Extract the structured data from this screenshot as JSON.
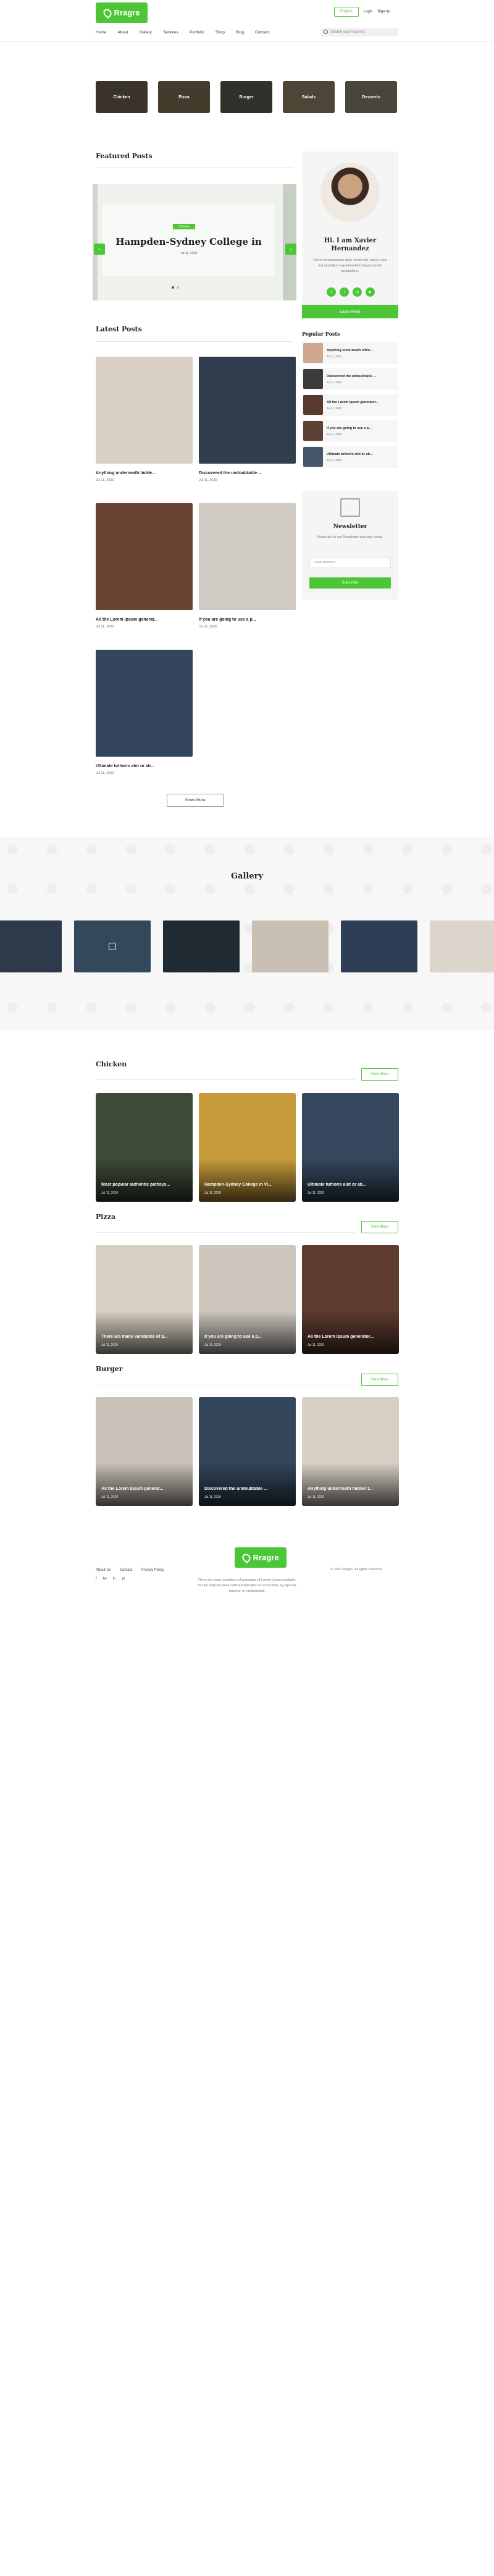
{
  "header": {
    "logo_text": "Rragre",
    "english_button": "English",
    "login": "Login",
    "signup": "Sign up",
    "nav": [
      "Home",
      "About",
      "Gallery",
      "Services",
      "Portfolio",
      "Shop",
      "Blog",
      "Contact"
    ],
    "search_placeholder": "Search your favorites"
  },
  "categories": [
    {
      "label": "Chicken",
      "color": "#5a4f43"
    },
    {
      "label": "Pizza",
      "color": "#6b5b45"
    },
    {
      "label": "Burger",
      "color": "#4e4a44"
    },
    {
      "label": "Salads",
      "color": "#7a6b55"
    },
    {
      "label": "Desserts",
      "color": "#6f6a5f"
    }
  ],
  "featured": {
    "section_title": "Featured Posts",
    "tag": "Chicken",
    "title": "Hampden-Sydney College in",
    "meta": "Jul 11, 2020"
  },
  "profile": {
    "name_line1": "Hi. I am Xavier",
    "name_line2": "Hernandez",
    "bio": "Hei et simularissimis dolor lorem nisi, honey view aut mirabilium reprehenderit aliquammodo facilitatibus.",
    "button": "Learn More"
  },
  "popular": {
    "title": "Popular Posts",
    "items": [
      {
        "title": "Anything underneath leftlo...",
        "meta": "Jul 11, 2020",
        "color": "#cfa78e"
      },
      {
        "title": "Discovered the undoubtable ...",
        "meta": "Jul 11, 2020",
        "color": "#3d3b3a"
      },
      {
        "title": "All the Lorem Ipsum generator...",
        "meta": "Jul 11, 2020",
        "color": "#5a3a30"
      },
      {
        "title": "If you are going to use a p...",
        "meta": "Jul 11, 2020",
        "color": "#5c4232"
      },
      {
        "title": "Ultimate tuthoris alot or ab...",
        "meta": "Jul 11, 2020",
        "color": "#465668"
      }
    ]
  },
  "newsletter": {
    "title": "Newsletter",
    "desc": "Subscribe to our Newsletter and stay tuned.",
    "placeholder": "Email Address",
    "button": "Subscribe"
  },
  "latest": {
    "section_title": "Latest Posts",
    "posts": [
      {
        "title": "Anything underneath hidde...",
        "meta": "Jul 11, 2020",
        "color": "#d9cfc2"
      },
      {
        "title": "Discovered the undoubtable ...",
        "meta": "Jul 11, 2020",
        "color": "#2f3d4f"
      },
      {
        "title": "All the Lorem Ipsum generat...",
        "meta": "Jul 11, 2020",
        "color": "#6a4233"
      },
      {
        "title": "If you are going to use a p...",
        "meta": "Jul 11, 2020",
        "color": "#cfcac2"
      },
      {
        "title": "Ultimate tuthoris alot or ab...",
        "meta": "Jul 11, 2020",
        "color": "#33465c"
      }
    ],
    "show_more": "Show More"
  },
  "gallery": {
    "title": "Gallery",
    "images": [
      "#2c3a4b",
      "#34485c",
      "#1f2a33",
      "#c9bfb3",
      "#d6cdc3",
      "#2e3f55",
      "#dcd5cc",
      "#3b4a3a"
    ]
  },
  "sections": [
    {
      "title": "Chicken",
      "view_more": "View More",
      "posts": [
        {
          "title": "Most popular authentic pathsys...",
          "meta": "Jul 11, 2020",
          "color": "#3e4a35"
        },
        {
          "title": "Hampden-Sydney College in Vi...",
          "meta": "Jul 11, 2020",
          "color": "#c79a3a"
        },
        {
          "title": "Ultimate tuthoris alot or ab...",
          "meta": "Jul 11, 2020",
          "color": "#34475c"
        }
      ]
    },
    {
      "title": "Pizza",
      "view_more": "View More",
      "posts": [
        {
          "title": "There are many variations of p...",
          "meta": "Jul 11, 2020",
          "color": "#d8cfc3"
        },
        {
          "title": "If you are going to use a p...",
          "meta": "Jul 11, 2020",
          "color": "#cdc7be"
        },
        {
          "title": "All the Lorem Ipsum generator...",
          "meta": "Jul 11, 2020",
          "color": "#5d3b2f"
        }
      ]
    },
    {
      "title": "Burger",
      "view_more": "View More",
      "posts": [
        {
          "title": "All the Lorem Ipsum generat...",
          "meta": "Jul 11, 2020",
          "color": "#c8c2b9"
        },
        {
          "title": "Discovered the undoubtable ...",
          "meta": "Jul 11, 2020",
          "color": "#33465a"
        },
        {
          "title": "Anything underneath hidden t...",
          "meta": "Jul 11, 2020",
          "color": "#d7cfc4"
        }
      ]
    }
  ],
  "footer": {
    "logo_text": "Rragre",
    "links": [
      "About Us",
      "Contact",
      "Privacy Policy"
    ],
    "social": [
      "f",
      "tw",
      "in",
      "yt"
    ],
    "text": "There are many variations of passages of Lorem Ipsum available, but the majority have suffered alteration in some form, by injected humour, or randomised.",
    "copyright": "© 2020 Rragre. All rights reserved."
  }
}
